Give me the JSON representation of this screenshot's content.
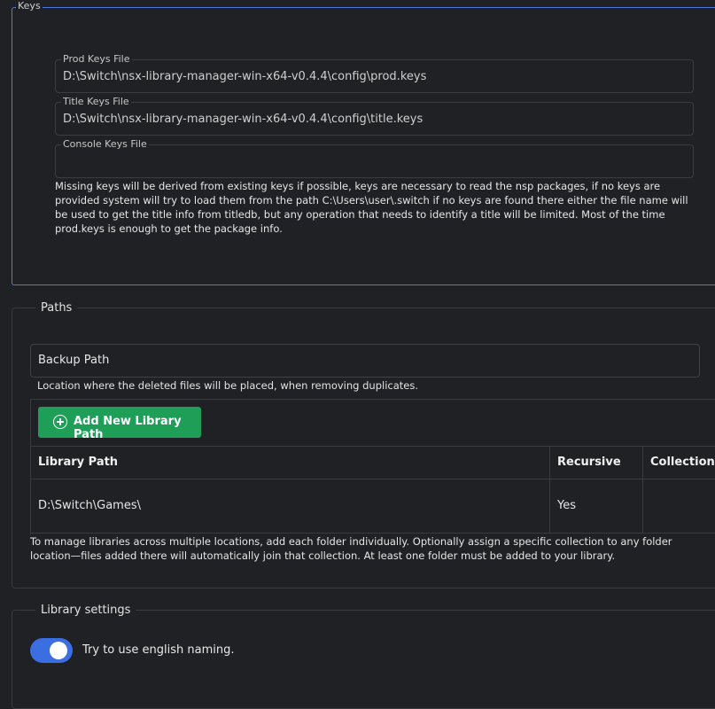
{
  "keys": {
    "legend": "Keys",
    "prod_keys": {
      "label": "Prod Keys File",
      "value": "D:\\Switch\\nsx-library-manager-win-x64-v0.4.4\\config\\prod.keys"
    },
    "title_keys": {
      "label": "Title Keys File",
      "value": "D:\\Switch\\nsx-library-manager-win-x64-v0.4.4\\config\\title.keys"
    },
    "console_keys": {
      "label": "Console Keys File",
      "value": ""
    },
    "help": "Missing keys will be derived from existing keys if possible, keys are necessary to read the nsp packages, if no keys are provided system will try to load them from the path C:\\Users\\user\\.switch if no keys are found there either the file name will be used to get the title info from titledb, but any operation that needs to identify a title will be limited. Most of the time prod.keys is enough to get the package info."
  },
  "paths": {
    "legend": "Paths",
    "backup_path": {
      "label": "Backup Path",
      "help": "Location where the deleted files will be placed, when removing duplicates."
    },
    "add_button": "Add New Library Path",
    "table": {
      "headers": [
        "Library Path",
        "Recursive",
        "Collection"
      ],
      "rows": [
        {
          "path": "D:\\Switch\\Games\\",
          "recursive": "Yes",
          "collection": ""
        }
      ]
    },
    "help": "To manage libraries across multiple locations, add each folder individually. Optionally assign a specific collection to any folder location—files added there will automatically join that collection. At least one folder must be added to your library."
  },
  "library_settings": {
    "legend": "Library settings",
    "english_naming": {
      "label": "Try to use english naming.",
      "enabled": true
    }
  },
  "colors": {
    "accent_blue": "#3b6ee0",
    "add_button_green": "#1e9e57",
    "background": "#202124"
  }
}
